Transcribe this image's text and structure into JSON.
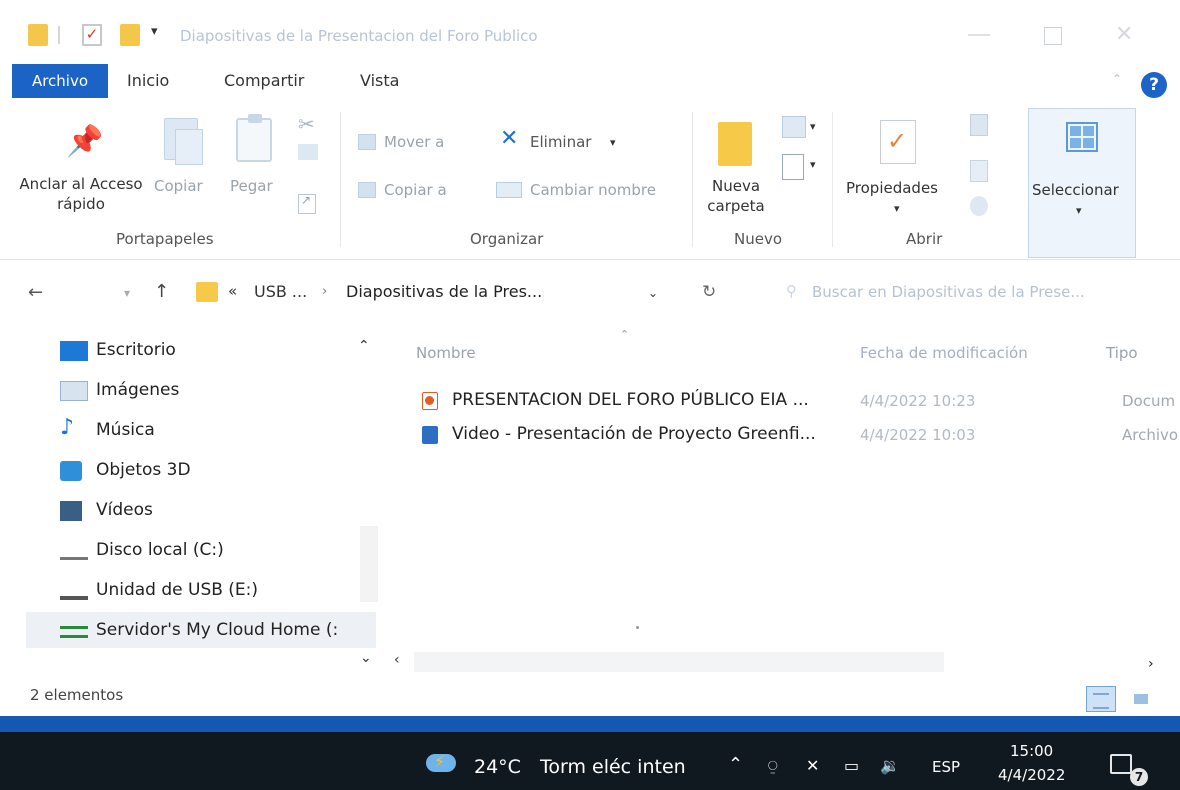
{
  "window": {
    "title": "Diapositivas de la Presentacion del Foro Publico"
  },
  "menu": {
    "tabs": [
      "Archivo",
      "Inicio",
      "Compartir",
      "Vista"
    ]
  },
  "ribbon": {
    "portapapeles": {
      "pin_label": "Anclar al Acceso rápido",
      "copy_label": "Copiar",
      "paste_label": "Pegar",
      "group": "Portapapeles"
    },
    "organizar": {
      "move_label": "Mover a",
      "copy_to_label": "Copiar a",
      "delete_label": "Eliminar",
      "rename_label": "Cambiar nombre",
      "group": "Organizar"
    },
    "nuevo": {
      "new_folder_label": "Nueva carpeta",
      "group": "Nuevo"
    },
    "abrir": {
      "properties_label": "Propiedades",
      "group": "Abrir"
    },
    "seleccionar": {
      "select_label": "Seleccionar"
    }
  },
  "address": {
    "root_crumb": "USB ...",
    "current_crumb": "Diapositivas de la Pres...",
    "search_placeholder": "Buscar en Diapositivas de la Prese..."
  },
  "nav_items": [
    {
      "label": "Escritorio",
      "icon": "desktop-icon"
    },
    {
      "label": "Imágenes",
      "icon": "images-icon"
    },
    {
      "label": "Música",
      "icon": "music-icon"
    },
    {
      "label": "Objetos 3D",
      "icon": "3d-objects-icon"
    },
    {
      "label": "Vídeos",
      "icon": "videos-icon"
    },
    {
      "label": "Disco local (C:)",
      "icon": "local-disk-icon"
    },
    {
      "label": "Unidad de USB (E:)",
      "icon": "usb-drive-icon"
    },
    {
      "label": "Servidor's My Cloud Home (:",
      "icon": "network-drive-icon"
    }
  ],
  "file_columns": {
    "name": "Nombre",
    "date": "Fecha de modificación",
    "type": "Tipo"
  },
  "files": [
    {
      "name": "PRESENTACION DEL FORO PÚBLICO EIA ...",
      "date": "4/4/2022 10:23",
      "type": "Docum",
      "icon": "powerpoint-file-icon"
    },
    {
      "name": "Video - Presentación de Proyecto Greenfi...",
      "date": "4/4/2022 10:03",
      "type": "Archivo",
      "icon": "video-file-icon"
    }
  ],
  "status": {
    "item_count": "2 elementos"
  },
  "taskbar": {
    "temperature": "24°C",
    "weather_desc": "Torm eléc inten",
    "language": "ESP",
    "time": "15:00",
    "date": "4/4/2022",
    "notification_count": "7"
  },
  "colors": {
    "accent": "#1b64c6",
    "taskbar": "#101820",
    "folder": "#f7c948"
  }
}
